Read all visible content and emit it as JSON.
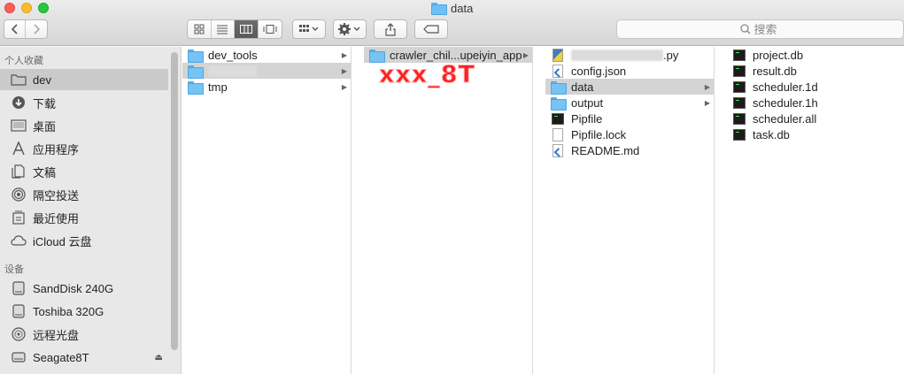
{
  "window": {
    "title": "data"
  },
  "search": {
    "placeholder": "搜索"
  },
  "sidebar": {
    "favorites_header": "个人收藏",
    "favorites": [
      {
        "label": "dev",
        "icon": "folder-icon",
        "selected": true
      },
      {
        "label": "下载",
        "icon": "download-icon"
      },
      {
        "label": "桌面",
        "icon": "desktop-icon"
      },
      {
        "label": "应用程序",
        "icon": "applications-icon"
      },
      {
        "label": "文稿",
        "icon": "documents-icon"
      },
      {
        "label": "隔空投送",
        "icon": "airdrop-icon"
      },
      {
        "label": "最近使用",
        "icon": "recents-icon"
      },
      {
        "label": "iCloud 云盘",
        "icon": "cloud-icon"
      }
    ],
    "devices_header": "设备",
    "devices": [
      {
        "label": "SandDisk 240G",
        "icon": "disk-icon"
      },
      {
        "label": "Toshiba 320G",
        "icon": "disk-icon"
      },
      {
        "label": "远程光盘",
        "icon": "optical-disc-icon"
      },
      {
        "label": "Seagate8T",
        "icon": "disk-icon",
        "eject": "⏏"
      }
    ]
  },
  "columns": {
    "col1": [
      {
        "label": "dev_tools",
        "type": "folder",
        "has_children": true
      },
      {
        "label": "",
        "type": "folder",
        "has_children": true,
        "selected": true,
        "redacted": true
      },
      {
        "label": "tmp",
        "type": "folder",
        "has_children": true
      }
    ],
    "col2": [
      {
        "label": "crawler_chil...upeiyin_app",
        "type": "folder",
        "has_children": true,
        "selected": true
      }
    ],
    "col3": [
      {
        "label": ".py",
        "type": "python",
        "redacted_prefix": true
      },
      {
        "label": "config.json",
        "type": "code"
      },
      {
        "label": "data",
        "type": "folder",
        "has_children": true,
        "selected": true
      },
      {
        "label": "output",
        "type": "folder",
        "has_children": true
      },
      {
        "label": "Pipfile",
        "type": "terminal"
      },
      {
        "label": "Pipfile.lock",
        "type": "doc"
      },
      {
        "label": "README.md",
        "type": "code"
      }
    ],
    "col4": [
      {
        "label": "project.db",
        "type": "terminal"
      },
      {
        "label": "result.db",
        "type": "terminal"
      },
      {
        "label": "scheduler.1d",
        "type": "terminal"
      },
      {
        "label": "scheduler.1h",
        "type": "terminal"
      },
      {
        "label": "scheduler.all",
        "type": "terminal"
      },
      {
        "label": "task.db",
        "type": "terminal"
      }
    ]
  },
  "annotation": {
    "text": "xxx_8T",
    "color": "#ff1f1f"
  },
  "colors": {
    "selection_gray": "#d4d4d4",
    "sidebar_bg": "#e8e8e8",
    "folder_blue": "#76c3f4"
  }
}
